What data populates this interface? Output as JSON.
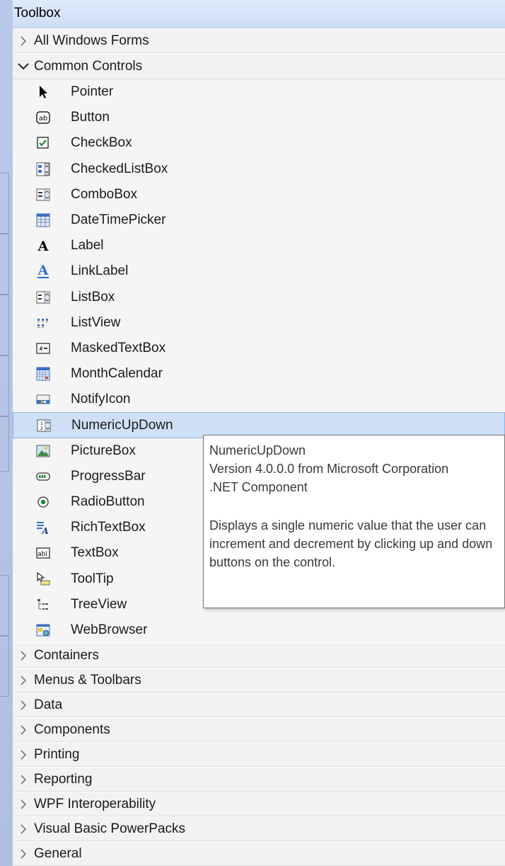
{
  "toolbox": {
    "title": "Toolbox"
  },
  "groups_before": [
    {
      "label": "All Windows Forms",
      "expanded": false
    }
  ],
  "common_controls": {
    "label": "Common Controls",
    "items": [
      {
        "label": "Pointer",
        "icon": "pointer-icon"
      },
      {
        "label": "Button",
        "icon": "button-icon"
      },
      {
        "label": "CheckBox",
        "icon": "checkbox-icon"
      },
      {
        "label": "CheckedListBox",
        "icon": "checkedlistbox-icon"
      },
      {
        "label": "ComboBox",
        "icon": "combobox-icon"
      },
      {
        "label": "DateTimePicker",
        "icon": "datetimepicker-icon"
      },
      {
        "label": "Label",
        "icon": "label-icon"
      },
      {
        "label": "LinkLabel",
        "icon": "linklabel-icon"
      },
      {
        "label": "ListBox",
        "icon": "listbox-icon"
      },
      {
        "label": "ListView",
        "icon": "listview-icon"
      },
      {
        "label": "MaskedTextBox",
        "icon": "maskedtextbox-icon"
      },
      {
        "label": "MonthCalendar",
        "icon": "monthcalendar-icon"
      },
      {
        "label": "NotifyIcon",
        "icon": "notifyicon-icon"
      },
      {
        "label": "NumericUpDown",
        "icon": "numericupdown-icon",
        "selected": true
      },
      {
        "label": "PictureBox",
        "icon": "picturebox-icon"
      },
      {
        "label": "ProgressBar",
        "icon": "progressbar-icon"
      },
      {
        "label": "RadioButton",
        "icon": "radiobutton-icon"
      },
      {
        "label": "RichTextBox",
        "icon": "richtextbox-icon"
      },
      {
        "label": "TextBox",
        "icon": "textbox-icon"
      },
      {
        "label": "ToolTip",
        "icon": "tooltip-icon"
      },
      {
        "label": "TreeView",
        "icon": "treeview-icon"
      },
      {
        "label": "WebBrowser",
        "icon": "webbrowser-icon"
      }
    ]
  },
  "groups_after": [
    {
      "label": "Containers"
    },
    {
      "label": "Menus & Toolbars"
    },
    {
      "label": "Data"
    },
    {
      "label": "Components"
    },
    {
      "label": "Printing"
    },
    {
      "label": "Reporting"
    },
    {
      "label": "WPF Interoperability"
    },
    {
      "label": "Visual Basic PowerPacks"
    },
    {
      "label": "General"
    }
  ],
  "tooltip": {
    "title": "NumericUpDown",
    "version": "Version 4.0.0.0 from Microsoft Corporation",
    "kind": ".NET Component",
    "description": "Displays a single numeric value that the user can increment and decrement by clicking up and down buttons on the control."
  },
  "colors": {
    "selection_bg": "#cfe0f6",
    "title_bg": "#cddcf6",
    "accent_blue": "#2a6fd6"
  }
}
